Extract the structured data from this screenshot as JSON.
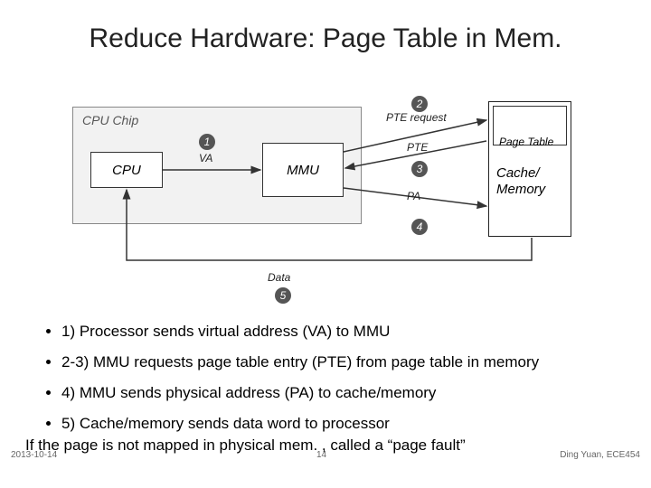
{
  "title": "Reduce Hardware: Page Table in Mem.",
  "diagram": {
    "chip_label": "CPU Chip",
    "cpu": "CPU",
    "mmu": "MMU",
    "page_table": "Page Table",
    "memory": "Cache/\nMemory",
    "labels": {
      "va": "VA",
      "pte_request": "PTE request",
      "pte": "PTE",
      "pa": "PA",
      "data": "Data"
    },
    "steps": {
      "s1": "1",
      "s2": "2",
      "s3": "3",
      "s4": "4",
      "s5": "5"
    }
  },
  "bullets": [
    "1) Processor sends virtual address (VA) to MMU",
    "2-3) MMU requests page table entry (PTE) from page table in memory",
    "4) MMU sends physical address (PA) to cache/memory",
    "5) Cache/memory sends data word to processor"
  ],
  "footnote": "If the page is not mapped in physical mem. , called a “page fault”",
  "footer": {
    "left": "2013-10-14",
    "center": "14",
    "right": "Ding Yuan, ECE454"
  }
}
